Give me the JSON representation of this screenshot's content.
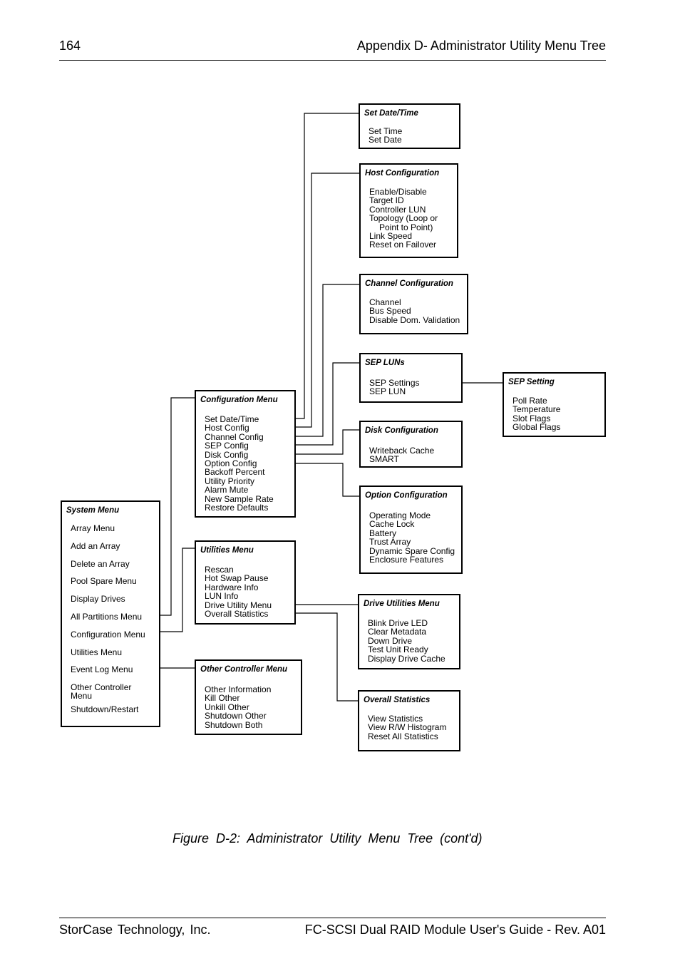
{
  "header": {
    "page_number": "164",
    "title": "Appendix D- Administrator Utility Menu Tree"
  },
  "footer": {
    "company": "StorCase Technology, Inc.",
    "document": "FC-SCSI Dual RAID Module User's Guide - Rev. A01"
  },
  "caption": "Figure D-2:  Administrator Utility Menu Tree (cont'd)",
  "menus": {
    "system": {
      "title": "System Menu",
      "items": [
        "Array Menu",
        "Add an Array",
        "Delete an Array",
        "Pool Spare Menu",
        "Display Drives",
        "All Partitions Menu",
        "Configuration Menu",
        "Utilities Menu",
        "Event Log Menu",
        "Other Controller Menu",
        "Shutdown/Restart"
      ]
    },
    "configuration": {
      "title": "Configuration Menu",
      "items": [
        "Set Date/Time",
        "Host Config",
        "Channel Config",
        "SEP Config",
        "Disk Config",
        "Option Config",
        "Backoff Percent",
        "Utility Priority",
        "Alarm Mute",
        "New Sample Rate",
        "Restore Defaults"
      ]
    },
    "utilities": {
      "title": "Utilities Menu",
      "items": [
        "Rescan",
        "Hot Swap Pause",
        "Hardware Info",
        "LUN Info",
        "Drive Utility Menu",
        "Overall Statistics"
      ]
    },
    "other_controller": {
      "title": "Other Controller  Menu",
      "items": [
        "Other Information",
        "Kill Other",
        "Unkill Other",
        "Shutdown Other",
        "Shutdown Both"
      ]
    },
    "set_date_time": {
      "title": "Set Date/Time",
      "items": [
        "Set Time",
        "Set Date"
      ]
    },
    "host_configuration": {
      "title": "Host Configuration",
      "items": [
        "Enable/Disable",
        "Target ID",
        "Controller LUN",
        "Topology (Loop or",
        "Point to Point)",
        "Link Speed",
        "Reset on Failover"
      ]
    },
    "channel_configuration": {
      "title": "Channel Configuration",
      "items": [
        "Channel",
        "Bus Speed",
        "Disable Dom. Validation"
      ]
    },
    "sep_luns": {
      "title": "SEP LUNs",
      "items": [
        "SEP Settings",
        "SEP LUN"
      ]
    },
    "sep_setting": {
      "title": "SEP Setting",
      "items": [
        "Poll Rate",
        "Temperature",
        "Slot Flags",
        "Global Flags"
      ]
    },
    "disk_configuration": {
      "title": "Disk Configuration",
      "items": [
        "Writeback Cache",
        "SMART"
      ]
    },
    "option_configuration": {
      "title": "Option Configuration",
      "items": [
        "Operating Mode",
        "Cache Lock",
        "Battery",
        "Trust Array",
        "Dynamic Spare Config",
        "Enclosure Features"
      ]
    },
    "drive_utilities": {
      "title": "Drive Utilities Menu",
      "items": [
        "Blink Drive LED",
        "Clear Metadata",
        "Down Drive",
        "Test Unit Ready",
        "Display Drive Cache"
      ]
    },
    "overall_statistics": {
      "title": "Overall Statistics",
      "items": [
        "View Statistics",
        "View R/W Histogram",
        "Reset All Statistics"
      ]
    }
  }
}
